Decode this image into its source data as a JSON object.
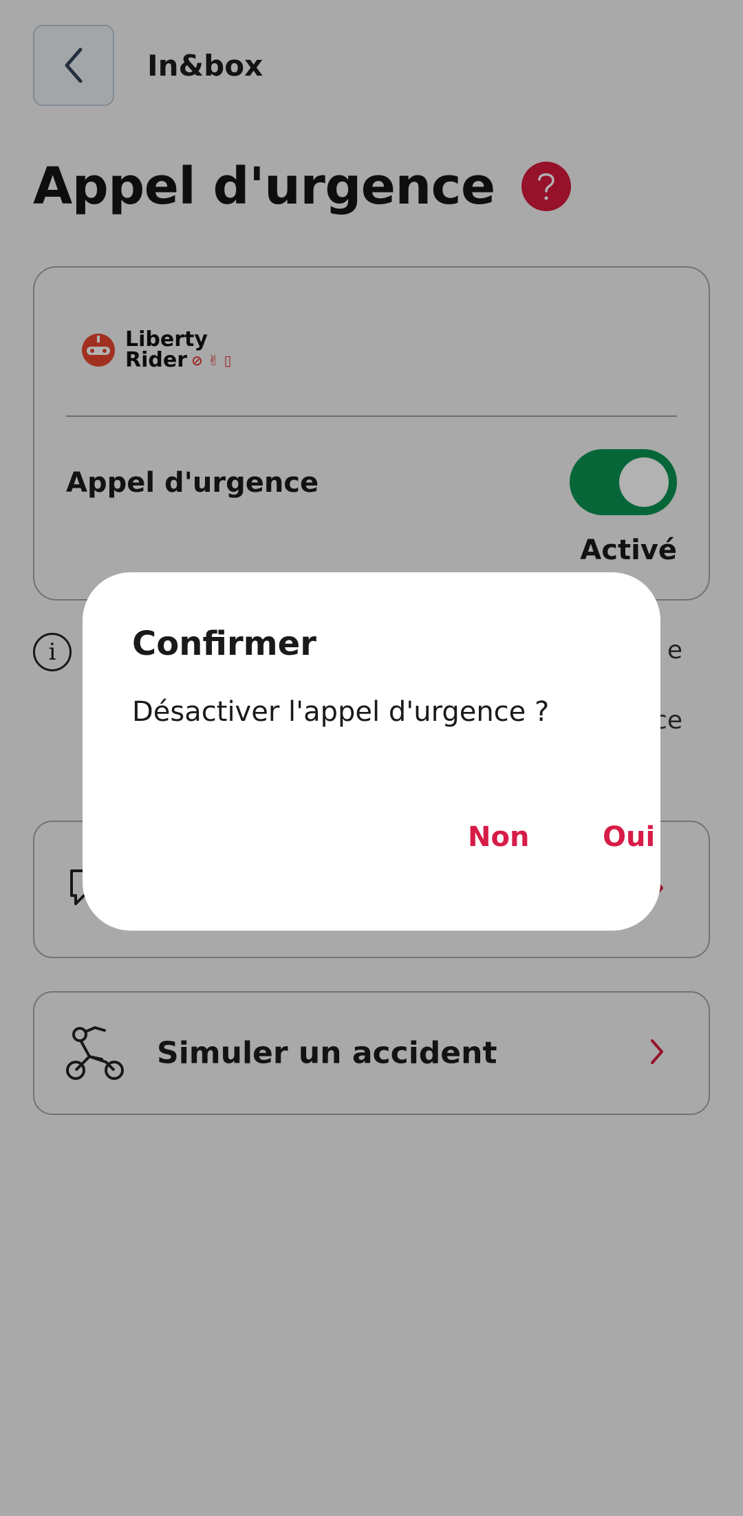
{
  "header": {
    "back_label": "Retour",
    "title": "In&box"
  },
  "page": {
    "title": "Appel d'urgence",
    "help_icon": "question-mark-icon",
    "help_color": "#d7193d"
  },
  "card": {
    "brand_line1": "Liberty",
    "brand_line2": "Rider",
    "toggle_label": "Appel d'urgence",
    "toggle_state": "Activé",
    "toggle_color": "#09924f"
  },
  "info": {
    "text": "e\nvice"
  },
  "rows": [
    {
      "icon": "chat-bubble-icon",
      "label": ""
    },
    {
      "icon": "motorcycle-rider-icon",
      "label": "Simuler un accident"
    }
  ],
  "dialog": {
    "title": "Confirmer",
    "message": "Désactiver l'appel d'urgence ?",
    "cancel_label": "Non",
    "confirm_label": "Oui",
    "button_color": "#d61c47"
  }
}
